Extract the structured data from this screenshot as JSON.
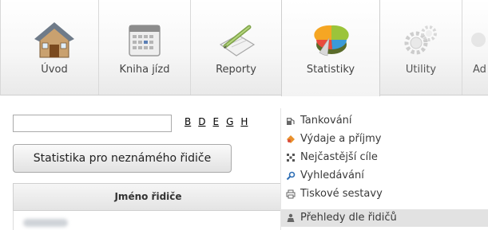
{
  "tabs": [
    {
      "label": "Úvod",
      "icon": "house-icon",
      "active": false
    },
    {
      "label": "Kniha jízd",
      "icon": "calendar-icon",
      "active": false
    },
    {
      "label": "Reporty",
      "icon": "notepad-pencil-icon",
      "active": false
    },
    {
      "label": "Statistiky",
      "icon": "pie-chart-icon",
      "active": true
    },
    {
      "label": "Utility",
      "icon": "gears-icon",
      "active": false
    },
    {
      "label": "Ad",
      "icon": "admin-icon",
      "active": false
    }
  ],
  "letter_filter": [
    "B",
    "D",
    "E",
    "G",
    "H"
  ],
  "search": {
    "value": "",
    "placeholder": ""
  },
  "unknown_driver_button": "Statistika pro neznámého řidiče",
  "table": {
    "column_header": "Jméno řidiče"
  },
  "dropdown": {
    "items": [
      {
        "label": "Tankování",
        "icon": "fuel-pump-icon"
      },
      {
        "label": "Výdaje a příjmy",
        "icon": "money-icon"
      },
      {
        "label": "Nejčastější cíle",
        "icon": "target-icon"
      },
      {
        "label": "Vyhledávání",
        "icon": "magnifier-icon"
      },
      {
        "label": "Tiskové sestavy",
        "icon": "printer-icon"
      },
      {
        "label": "Přehledy dle řidičů",
        "icon": "driver-icon",
        "highlighted": true
      }
    ]
  },
  "colors": {
    "active_tab_bg": "#f3f3f3",
    "highlight_row": "#e2e2e2",
    "link": "#000000"
  }
}
